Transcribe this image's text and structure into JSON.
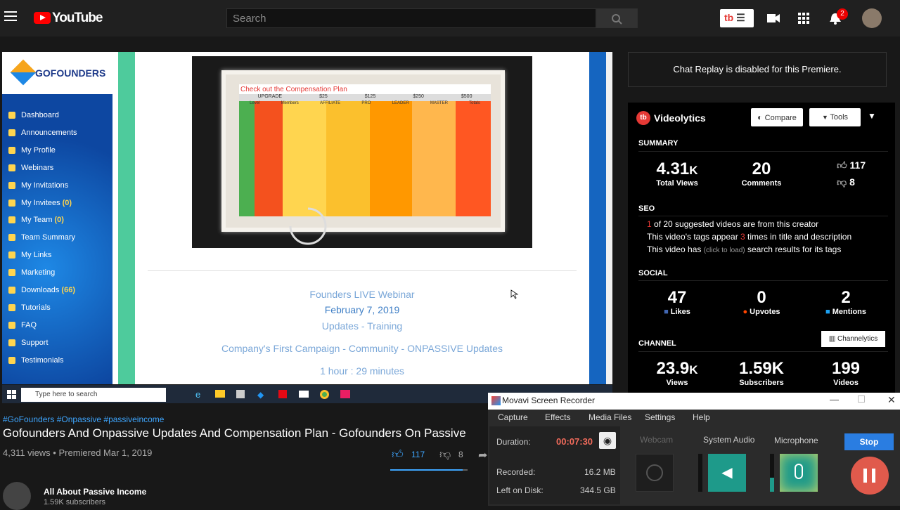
{
  "youtube": {
    "logo_text": "YouTube",
    "search_placeholder": "Search",
    "notif_count": "2",
    "tb_label": "tb"
  },
  "gofounders": {
    "logo": "GOFOUNDERS",
    "menu": [
      {
        "label": "Dashboard",
        "count": ""
      },
      {
        "label": "Announcements",
        "count": ""
      },
      {
        "label": "My Profile",
        "count": ""
      },
      {
        "label": "Webinars",
        "count": ""
      },
      {
        "label": "My Invitations",
        "count": ""
      },
      {
        "label": "My Invitees",
        "count": "(0)"
      },
      {
        "label": "My Team",
        "count": "(0)"
      },
      {
        "label": "Team Summary",
        "count": ""
      },
      {
        "label": "My Links",
        "count": ""
      },
      {
        "label": "Marketing",
        "count": ""
      },
      {
        "label": "Downloads",
        "count": "(66)"
      },
      {
        "label": "Tutorials",
        "count": ""
      },
      {
        "label": "FAQ",
        "count": ""
      },
      {
        "label": "Support",
        "count": ""
      },
      {
        "label": "Testimonials",
        "count": ""
      }
    ],
    "slide_title": "Check out the Compensation Plan",
    "slide_cols": [
      "UPGRADE",
      "$25",
      "$125",
      "$250",
      "$500"
    ],
    "slide_subcols": [
      "Level",
      "Members",
      "AFFILIATE",
      "PRO",
      "LEADER",
      "MASTER",
      "Totals"
    ],
    "webinar": {
      "line1": "Founders LIVE Webinar",
      "line2": "February 7, 2019",
      "line3": "Updates  - Training",
      "line4": "Company's First Campaign - Community - ONPASSIVE Updates",
      "line5": "1 hour : 29 minutes"
    },
    "taskbar_search": "Type here to search"
  },
  "video": {
    "tags": "#GoFounders #Onpassive #passiveincome",
    "title": "Gofounders And Onpassive Updates And Compensation Plan - Gofounders On Passive",
    "meta": "4,311 views • Premiered Mar 1, 2019",
    "likes": "117",
    "dislikes": "8",
    "like_ratio": 0.936
  },
  "channel": {
    "name": "All About Passive Income",
    "subs": "1.59K subscribers"
  },
  "chat": {
    "text": "Chat Replay is disabled for this Premiere."
  },
  "videolytics": {
    "title": "Videolytics",
    "compare": "Compare",
    "tools": "Tools",
    "summary_h": "SUMMARY",
    "total_views": "4.31",
    "total_views_unit": "K",
    "total_views_lbl": "Total Views",
    "comments": "20",
    "comments_lbl": "Comments",
    "likes": "117",
    "dislikes": "8",
    "seo_h": "SEO",
    "seo1_num": "1",
    "seo1_txt": " of 20 suggested videos are from this creator",
    "seo2_pre": "This video's tags appear ",
    "seo2_num": "3",
    "seo2_post": " times in title and description",
    "seo3_pre": "This video has ",
    "seo3_mid": "(click to load)",
    "seo3_post": " search results for its tags",
    "social_h": "SOCIAL",
    "s_likes": "47",
    "s_likes_lbl": "Likes",
    "s_upvotes": "0",
    "s_upvotes_lbl": "Upvotes",
    "s_mentions": "2",
    "s_mentions_lbl": "Mentions",
    "channel_h": "CHANNEL",
    "channelytics": "Channelytics",
    "c_views": "23.9",
    "c_views_unit": "K",
    "c_views_lbl": "Views",
    "c_subs": "1.59K",
    "c_subs_lbl": "Subscribers",
    "c_videos": "199",
    "c_videos_lbl": "Videos"
  },
  "movavi": {
    "title": "Movavi Screen Recorder",
    "menu": [
      "Capture",
      "Effects",
      "Media Files",
      "Settings",
      "Help"
    ],
    "duration_lbl": "Duration:",
    "duration": "00:07:30",
    "recorded_lbl": "Recorded:",
    "recorded": "16.2 MB",
    "left_lbl": "Left on Disk:",
    "left": "344.5 GB",
    "webcam": "Webcam",
    "system_audio": "System Audio",
    "microphone": "Microphone",
    "stop": "Stop"
  }
}
